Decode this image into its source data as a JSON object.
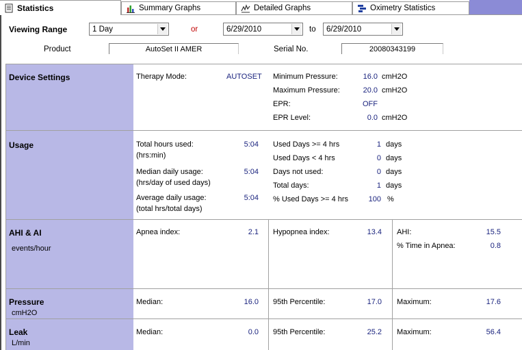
{
  "tabs": [
    {
      "label": "Statistics",
      "icon": "document-icon"
    },
    {
      "label": "Summary Graphs",
      "icon": "bar-chart-icon"
    },
    {
      "label": "Detailed Graphs",
      "icon": "line-graph-icon"
    },
    {
      "label": "Oximetry Statistics",
      "icon": "gantt-icon"
    }
  ],
  "filters": {
    "viewing_range_label": "Viewing Range",
    "range_value": "1 Day",
    "or_label": "or",
    "start_date": "6/29/2010",
    "to_label": "to",
    "end_date": "6/29/2010",
    "product_label": "Product",
    "product_value": "AutoSet II AMER",
    "serial_label": "Serial No.",
    "serial_value": "20080343199"
  },
  "device_settings": {
    "title": "Device Settings",
    "therapy_mode_label": "Therapy Mode:",
    "therapy_mode_value": "AUTOSET",
    "min_pressure_label": "Minimum Pressure:",
    "min_pressure_value": "16.0",
    "min_pressure_unit": "cmH2O",
    "max_pressure_label": "Maximum Pressure:",
    "max_pressure_value": "20.0",
    "max_pressure_unit": "cmH2O",
    "epr_label": "EPR:",
    "epr_value": "OFF",
    "epr_level_label": "EPR Level:",
    "epr_level_value": "0.0",
    "epr_level_unit": "cmH2O"
  },
  "usage": {
    "title": "Usage",
    "total_hours_label": "Total hours used:",
    "total_hours_sub": "(hrs:min)",
    "total_hours_value": "5:04",
    "median_label": "Median daily usage:",
    "median_sub": "(hrs/day of used days)",
    "median_value": "5:04",
    "average_label": "Average daily usage:",
    "average_sub": "(total hrs/total days)",
    "average_value": "5:04",
    "used_ge4_label": "Used Days >= 4 hrs",
    "used_ge4_value": "1",
    "used_lt4_label": "Used Days < 4 hrs",
    "used_lt4_value": "0",
    "not_used_label": "Days not used:",
    "not_used_value": "0",
    "total_days_label": "Total days:",
    "total_days_value": "1",
    "pct_label": "% Used Days >= 4 hrs",
    "pct_value": "100",
    "days_unit": "days",
    "pct_unit": "%"
  },
  "ahi": {
    "title": "AHI & AI",
    "subtitle": "events/hour",
    "apnea_label": "Apnea index:",
    "apnea_value": "2.1",
    "hypopnea_label": "Hypopnea index:",
    "hypopnea_value": "13.4",
    "ahi_label": "AHI:",
    "ahi_value": "15.5",
    "time_apnea_label": "% Time in Apnea:",
    "time_apnea_value": "0.8"
  },
  "pressure": {
    "title": "Pressure",
    "subtitle": "cmH2O",
    "median_label": "Median:",
    "median_value": "16.0",
    "p95_label": "95th Percentile:",
    "p95_value": "17.0",
    "max_label": "Maximum:",
    "max_value": "17.6"
  },
  "leak": {
    "title": "Leak",
    "subtitle": "L/min",
    "median_label": "Median:",
    "median_value": "0.0",
    "p95_label": "95th Percentile:",
    "p95_value": "25.2",
    "max_label": "Maximum:",
    "max_value": "56.4"
  },
  "colors": {
    "section_header": "#b8b8e6",
    "value_text": "#1a237e",
    "or_text": "#c00000",
    "tab_fill": "#8b8bd6"
  }
}
